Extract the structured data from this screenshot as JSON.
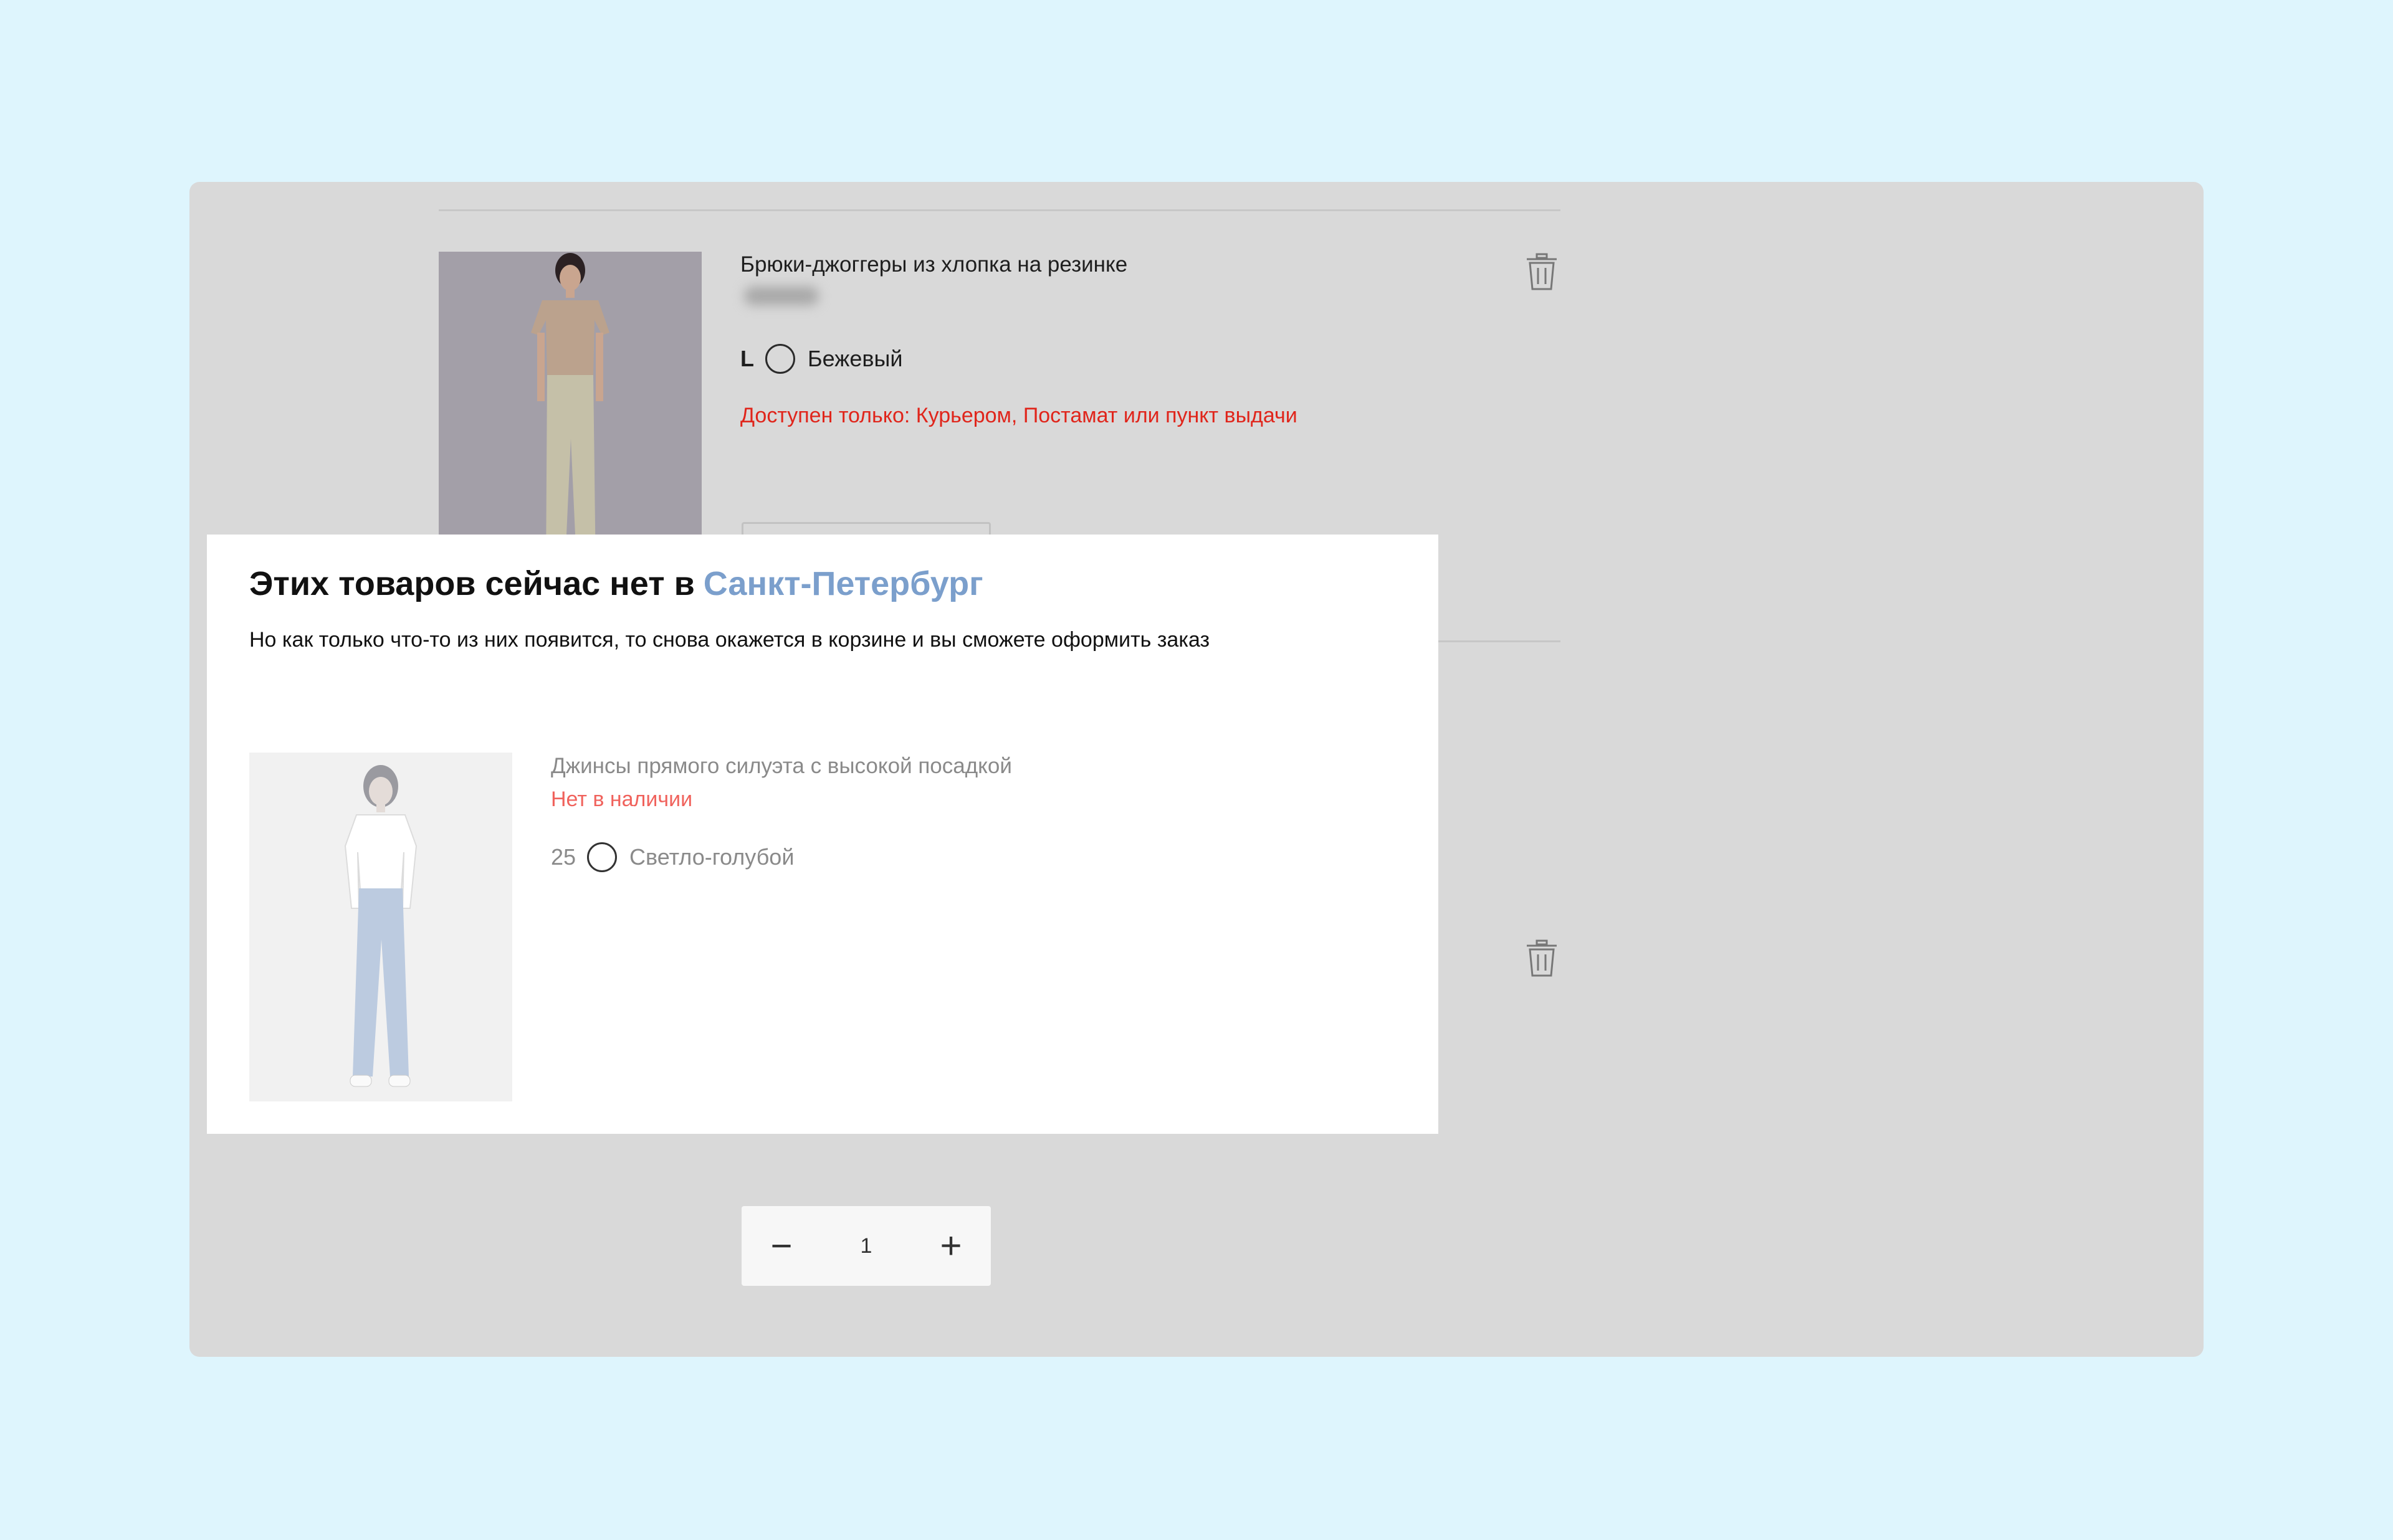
{
  "cart": {
    "items": [
      {
        "name": "Брюки-джоггеры из хлопка на резинке",
        "size": "L",
        "color_name": "Бежевый",
        "availability": "Доступен только: Курьером, Постамат или пункт выдачи",
        "quantity": "1",
        "decrement_label": "−",
        "increment_label": "+"
      }
    ]
  },
  "unavailable": {
    "title": "Этих товаров сейчас нет в",
    "city": "Санкт-Петербург",
    "subtitle": "Но как только что-то из них появится, то снова окажется в корзине и вы сможете оформить заказ",
    "items": [
      {
        "name": "Джинсы прямого силуэта с высокой посадкой",
        "status": "Нет в наличии",
        "size": "25",
        "color_name": "Светло-голубой",
        "quantity": "1",
        "decrement_label": "−",
        "increment_label": "+"
      }
    ]
  },
  "colors": {
    "page_background": "#def5fd",
    "overlay": "#d9d9d9",
    "alert_red": "#e0251b",
    "city_link": "#7b9fcc"
  },
  "icons": [
    "trash-icon",
    "trash-icon"
  ]
}
